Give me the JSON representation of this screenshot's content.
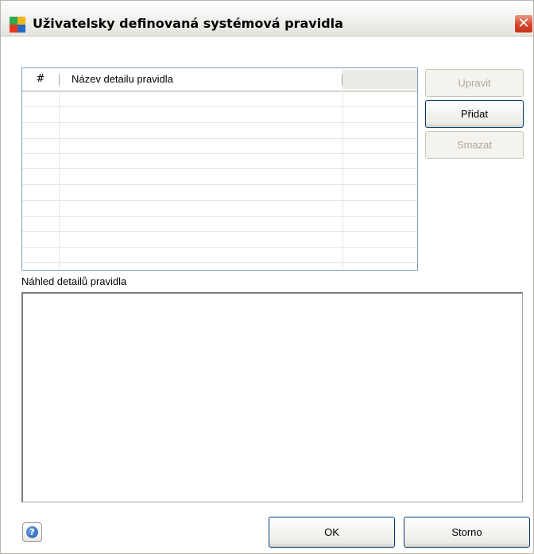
{
  "window": {
    "title": "Uživatelsky definovaná systémová pravidla",
    "close_glyph": "✕"
  },
  "grid": {
    "columns": [
      "#",
      "Název detailu pravidla",
      ""
    ],
    "rows": []
  },
  "side_buttons": {
    "edit_label": "Upravit",
    "add_label": "Přidat",
    "delete_label": "Smazat"
  },
  "preview": {
    "label": "Náhled detailů pravidla",
    "content": ""
  },
  "footer": {
    "help_glyph": "?",
    "ok_label": "OK",
    "cancel_label": "Storno"
  },
  "colors": {
    "accent_border": "#003c74",
    "grid_border": "#7f9db9",
    "close_red": "#d6452a"
  },
  "icons": [
    "avg-app-icon",
    "close-icon",
    "help-icon"
  ]
}
